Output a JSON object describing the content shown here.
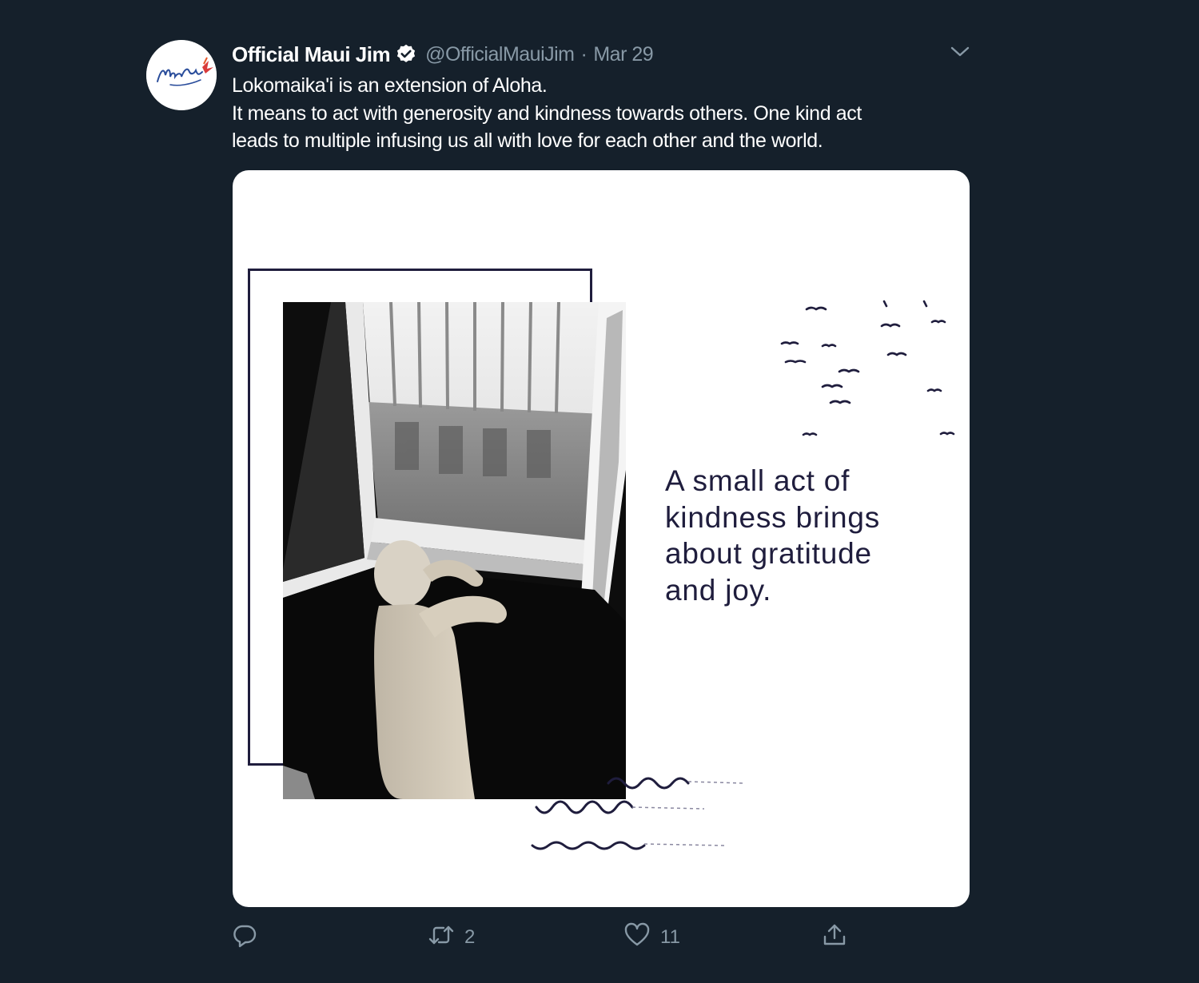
{
  "tweet": {
    "author": {
      "display_name": "Official Maui Jim",
      "handle": "@OfficialMauiJim",
      "verified": true,
      "avatar_icon": "maui-jim-logo"
    },
    "separator": "·",
    "date": "Mar 29",
    "text_lines": [
      "Lokomaika'i is an extension of Aloha.",
      "It means to act with generosity and kindness towards others. One kind act",
      "leads to multiple infusing us all with love for each other and the world."
    ],
    "media": {
      "caption_lines": [
        "A small act of",
        "kindness brings",
        "about gratitude",
        "and joy."
      ]
    },
    "actions": {
      "reply": {
        "icon": "reply-icon",
        "count": ""
      },
      "retweet": {
        "icon": "retweet-icon",
        "count": "2"
      },
      "like": {
        "icon": "heart-icon",
        "count": "11"
      },
      "share": {
        "icon": "share-icon",
        "count": ""
      }
    }
  },
  "colors": {
    "background": "#15202b",
    "text_primary": "#ffffff",
    "text_secondary": "#8899a6",
    "verified_badge": "#ffffff",
    "card_ink": "#1f1d3d",
    "card_background": "#ffffff"
  }
}
